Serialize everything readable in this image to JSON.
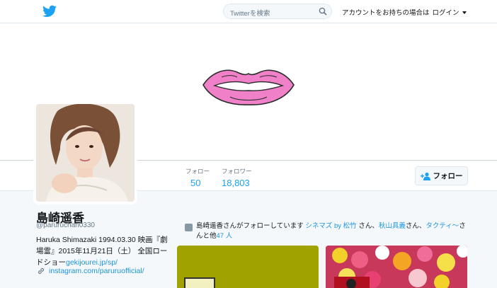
{
  "topbar": {
    "search_placeholder": "Twitterを検索",
    "login_prompt": "アカウントをお持ちの場合は",
    "login_label": "ログイン"
  },
  "profile": {
    "name": "島崎遥香",
    "handle": "@paruruchan0330",
    "bio_text": "Haruka Shimazaki 1994.03.30 映画『劇場霊』2015年11月21日（土） 全国ロードショー",
    "bio_link": "gekijourei.jp/sp/",
    "url": "instagram.com/paruruofficial/"
  },
  "stats": {
    "following_label": "フォロー",
    "following_value": "50",
    "followers_label": "フォロワー",
    "followers_value": "18,803"
  },
  "follow_button": "フォロー",
  "followed_by": {
    "prefix": "島崎遥香さんがフォローしています",
    "user1": "シネマズ by 松竹",
    "sep1": "さん、",
    "user2": "秋山具義",
    "sep2": "さん、",
    "user3": "タクティ〜",
    "suffix": "さんと他",
    "others": "47 人"
  },
  "colors": {
    "accent": "#1da1f2",
    "link": "#1b95e0",
    "lips": "#f080c8"
  },
  "icons": {
    "logo": "twitter-bird-icon",
    "search": "search-icon",
    "follow": "add-user-icon",
    "link": "link-icon"
  }
}
